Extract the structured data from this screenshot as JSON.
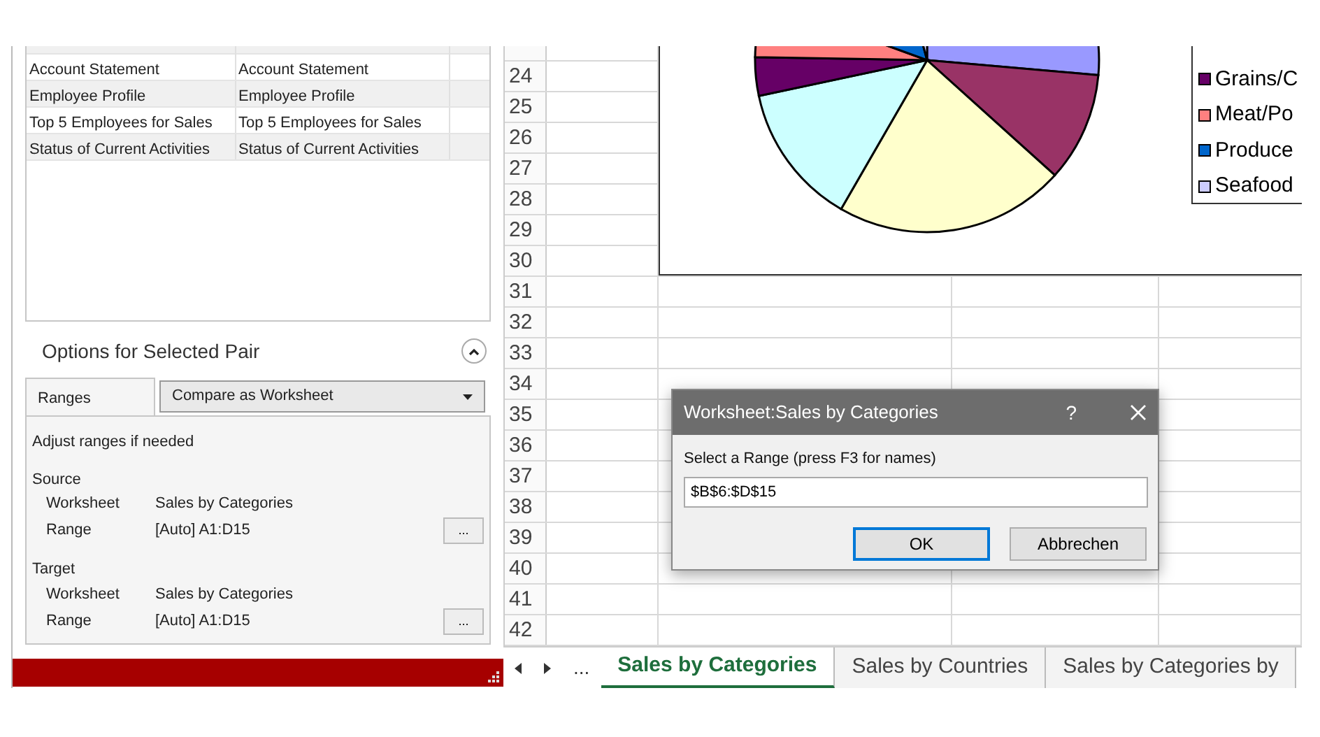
{
  "pair_list": {
    "rows": [
      {
        "cells": [
          "Account Statement",
          "Account Statement"
        ]
      },
      {
        "cells": [
          "Employee Profile",
          "Employee Profile"
        ]
      },
      {
        "cells": [
          "Top 5 Employees for Sales",
          "Top 5 Employees for Sales"
        ]
      },
      {
        "cells": [
          "Status of Current Activities",
          "Status of Current Activities"
        ]
      }
    ]
  },
  "options": {
    "title": "Options for Selected Pair",
    "expanded": true,
    "tab": "Ranges",
    "compare_mode": "Compare as Worksheet",
    "hint": "Adjust ranges if needed",
    "groups": [
      {
        "label": "Source",
        "worksheet_label": "Worksheet",
        "worksheet": "Sales by Categories",
        "range_label": "Range",
        "range": "[Auto] A1:D15",
        "browse": "..."
      },
      {
        "label": "Target",
        "worksheet_label": "Worksheet",
        "worksheet": "Sales by Categories",
        "range_label": "Range",
        "range": "[Auto] A1:D15",
        "browse": "..."
      }
    ]
  },
  "sheet": {
    "row_numbers": [
      "24",
      "25",
      "26",
      "27",
      "28",
      "29",
      "30",
      "31",
      "32",
      "33",
      "34",
      "35",
      "36",
      "37",
      "38",
      "39",
      "40",
      "41",
      "42"
    ],
    "chart": {
      "legend": [
        {
          "label": "Grains/C",
          "color": "#660066"
        },
        {
          "label": "Meat/Po",
          "color": "#ff8080"
        },
        {
          "label": "Produce",
          "color": "#0066cc"
        },
        {
          "label": "Seafood",
          "color": "#ccccff"
        }
      ]
    },
    "dialog": {
      "title": "Worksheet:Sales by Categories",
      "help": "?",
      "label": "Select a Range (press F3 for names)",
      "value": "$B$6:$D$15",
      "buttons": [
        {
          "label": "OK",
          "default": true
        },
        {
          "label": "Abbrechen",
          "default": false
        }
      ]
    },
    "more_tabs": "...",
    "tabs": [
      {
        "label": "Sales by Categories",
        "selected": true
      },
      {
        "label": "Sales by Countries",
        "selected": false
      },
      {
        "label": "Sales by Categories by",
        "selected": false
      }
    ]
  }
}
